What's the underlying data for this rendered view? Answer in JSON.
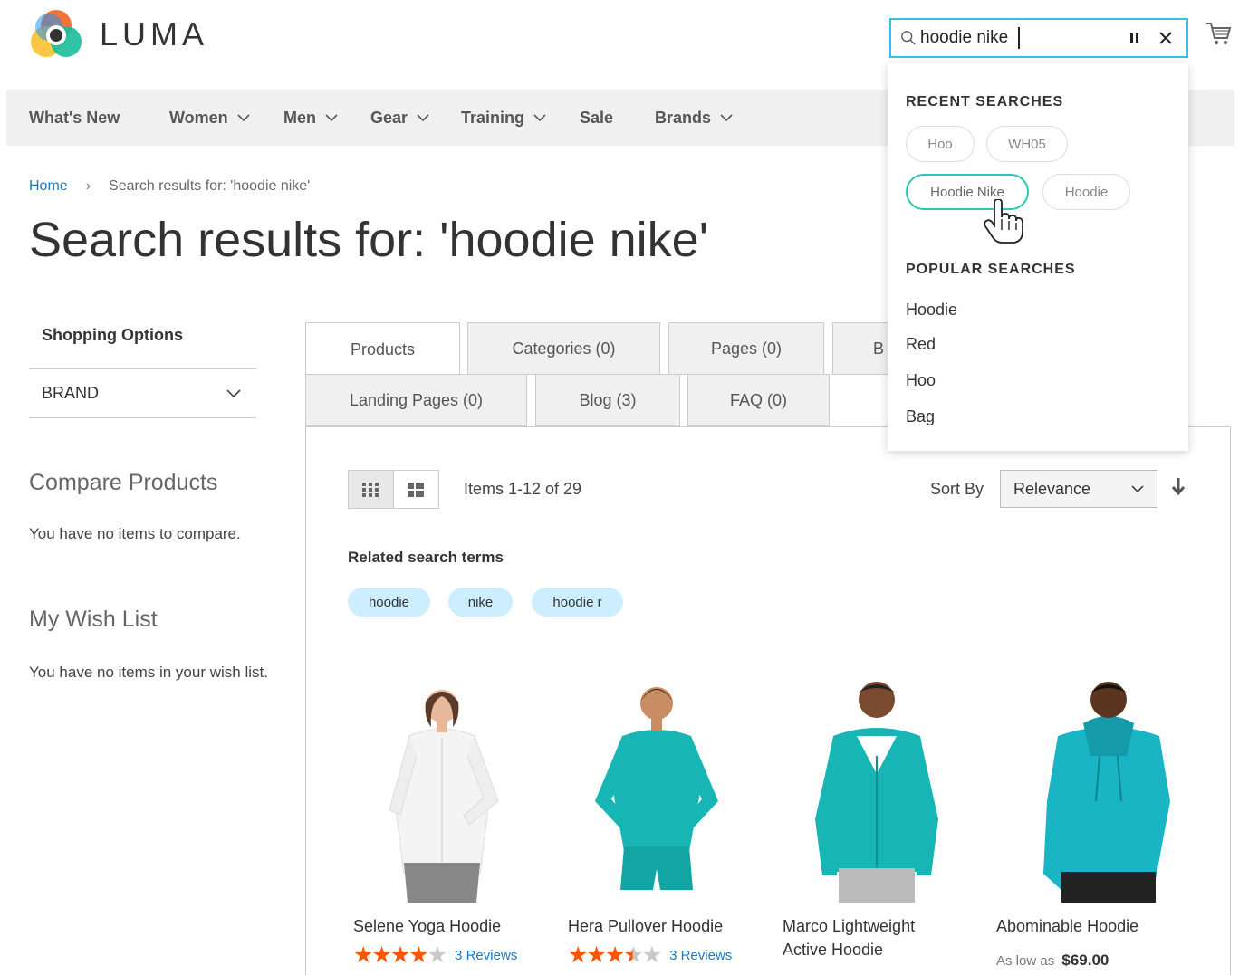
{
  "header": {
    "logo_text": "LUMA",
    "search_value": "hoodie nike",
    "brand_colors": {
      "accent": "#34c3e4",
      "highlight": "#2ec6b5",
      "link": "#1979c3",
      "star": "#ff5501"
    }
  },
  "nav": {
    "items": [
      {
        "label": "What's New",
        "has_dropdown": false
      },
      {
        "label": "Women",
        "has_dropdown": true
      },
      {
        "label": "Men",
        "has_dropdown": true
      },
      {
        "label": "Gear",
        "has_dropdown": true
      },
      {
        "label": "Training",
        "has_dropdown": true
      },
      {
        "label": "Sale",
        "has_dropdown": false
      },
      {
        "label": "Brands",
        "has_dropdown": true
      }
    ]
  },
  "breadcrumb": {
    "home": "Home",
    "current": "Search results for: 'hoodie nike'"
  },
  "page_title": "Search results for: 'hoodie nike'",
  "sidebar": {
    "shopping_options": "Shopping Options",
    "filter_brand": "BRAND",
    "compare_title": "Compare Products",
    "compare_text": "You have no items to compare.",
    "wishlist_title": "My Wish List",
    "wishlist_text": "You have no items in your wish list."
  },
  "tabs": [
    {
      "label": "Products",
      "active": true
    },
    {
      "label": "Categories (0)",
      "active": false
    },
    {
      "label": "Pages (0)",
      "active": false
    },
    {
      "label": "B",
      "active": false
    },
    {
      "label": "Landing Pages (0)",
      "active": false
    },
    {
      "label": "Blog (3)",
      "active": false
    },
    {
      "label": "FAQ (0)",
      "active": false
    }
  ],
  "toolbar": {
    "items_count": "Items 1-12 of 29",
    "sort_label": "Sort By",
    "sort_value": "Relevance",
    "view_mode": "grid"
  },
  "related": {
    "title": "Related search terms",
    "terms": [
      "hoodie",
      "nike",
      "hoodie r"
    ]
  },
  "products": [
    {
      "name": "Selene Yoga Hoodie",
      "rating": 4,
      "reviews": "3 Reviews",
      "price_prefix": "",
      "price": ""
    },
    {
      "name": "Hera Pullover Hoodie",
      "rating": 3.5,
      "reviews": "3 Reviews",
      "price_prefix": "",
      "price": ""
    },
    {
      "name": "Marco Lightweight Active Hoodie",
      "rating": null,
      "reviews": "",
      "price_prefix": "",
      "price": ""
    },
    {
      "name": "Abominable Hoodie",
      "rating": null,
      "reviews": "",
      "price_prefix": "As low as",
      "price": "$69.00"
    }
  ],
  "dropdown": {
    "recent_title": "RECENT SEARCHES",
    "recent": [
      "Hoo",
      "WH05",
      "Hoodie Nike",
      "Hoodie"
    ],
    "recent_highlighted": "Hoodie Nike",
    "popular_title": "POPULAR SEARCHES",
    "popular": [
      "Hoodie",
      "Red",
      "Hoo",
      "Bag"
    ]
  }
}
